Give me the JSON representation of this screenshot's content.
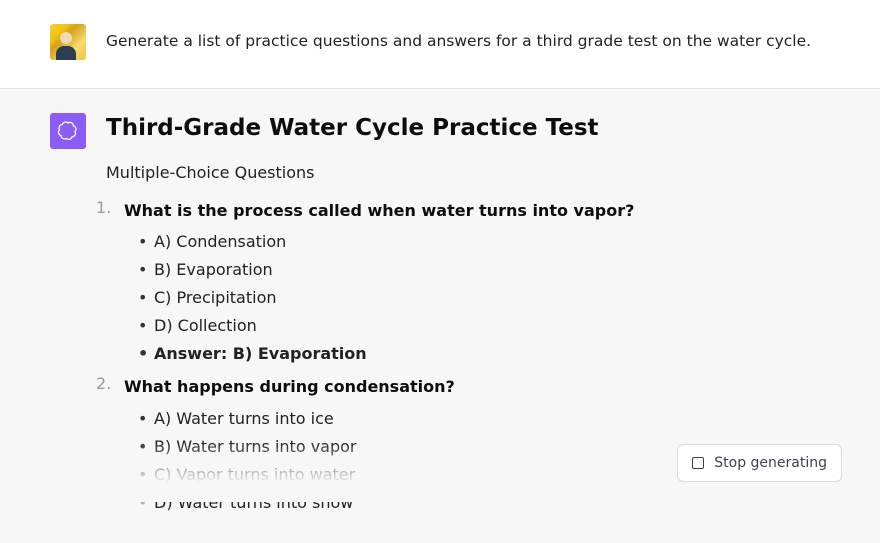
{
  "user": {
    "prompt": "Generate a list of practice questions and answers for a third grade test on the water cycle."
  },
  "assistant": {
    "title": "Third-Grade Water Cycle Practice Test",
    "subtitle": "Multiple-Choice Questions",
    "questions": [
      {
        "text": "What is the process called when water turns into vapor?",
        "options": [
          "A) Condensation",
          "B) Evaporation",
          "C) Precipitation",
          "D) Collection"
        ],
        "answer": "Answer: B) Evaporation"
      },
      {
        "text": "What happens during condensation?",
        "options": [
          "A) Water turns into ice",
          "B) Water turns into vapor",
          "C) Vapor turns into water",
          "D) Water turns into snow"
        ],
        "answer": ""
      }
    ]
  },
  "controls": {
    "stop_label": "Stop generating"
  }
}
